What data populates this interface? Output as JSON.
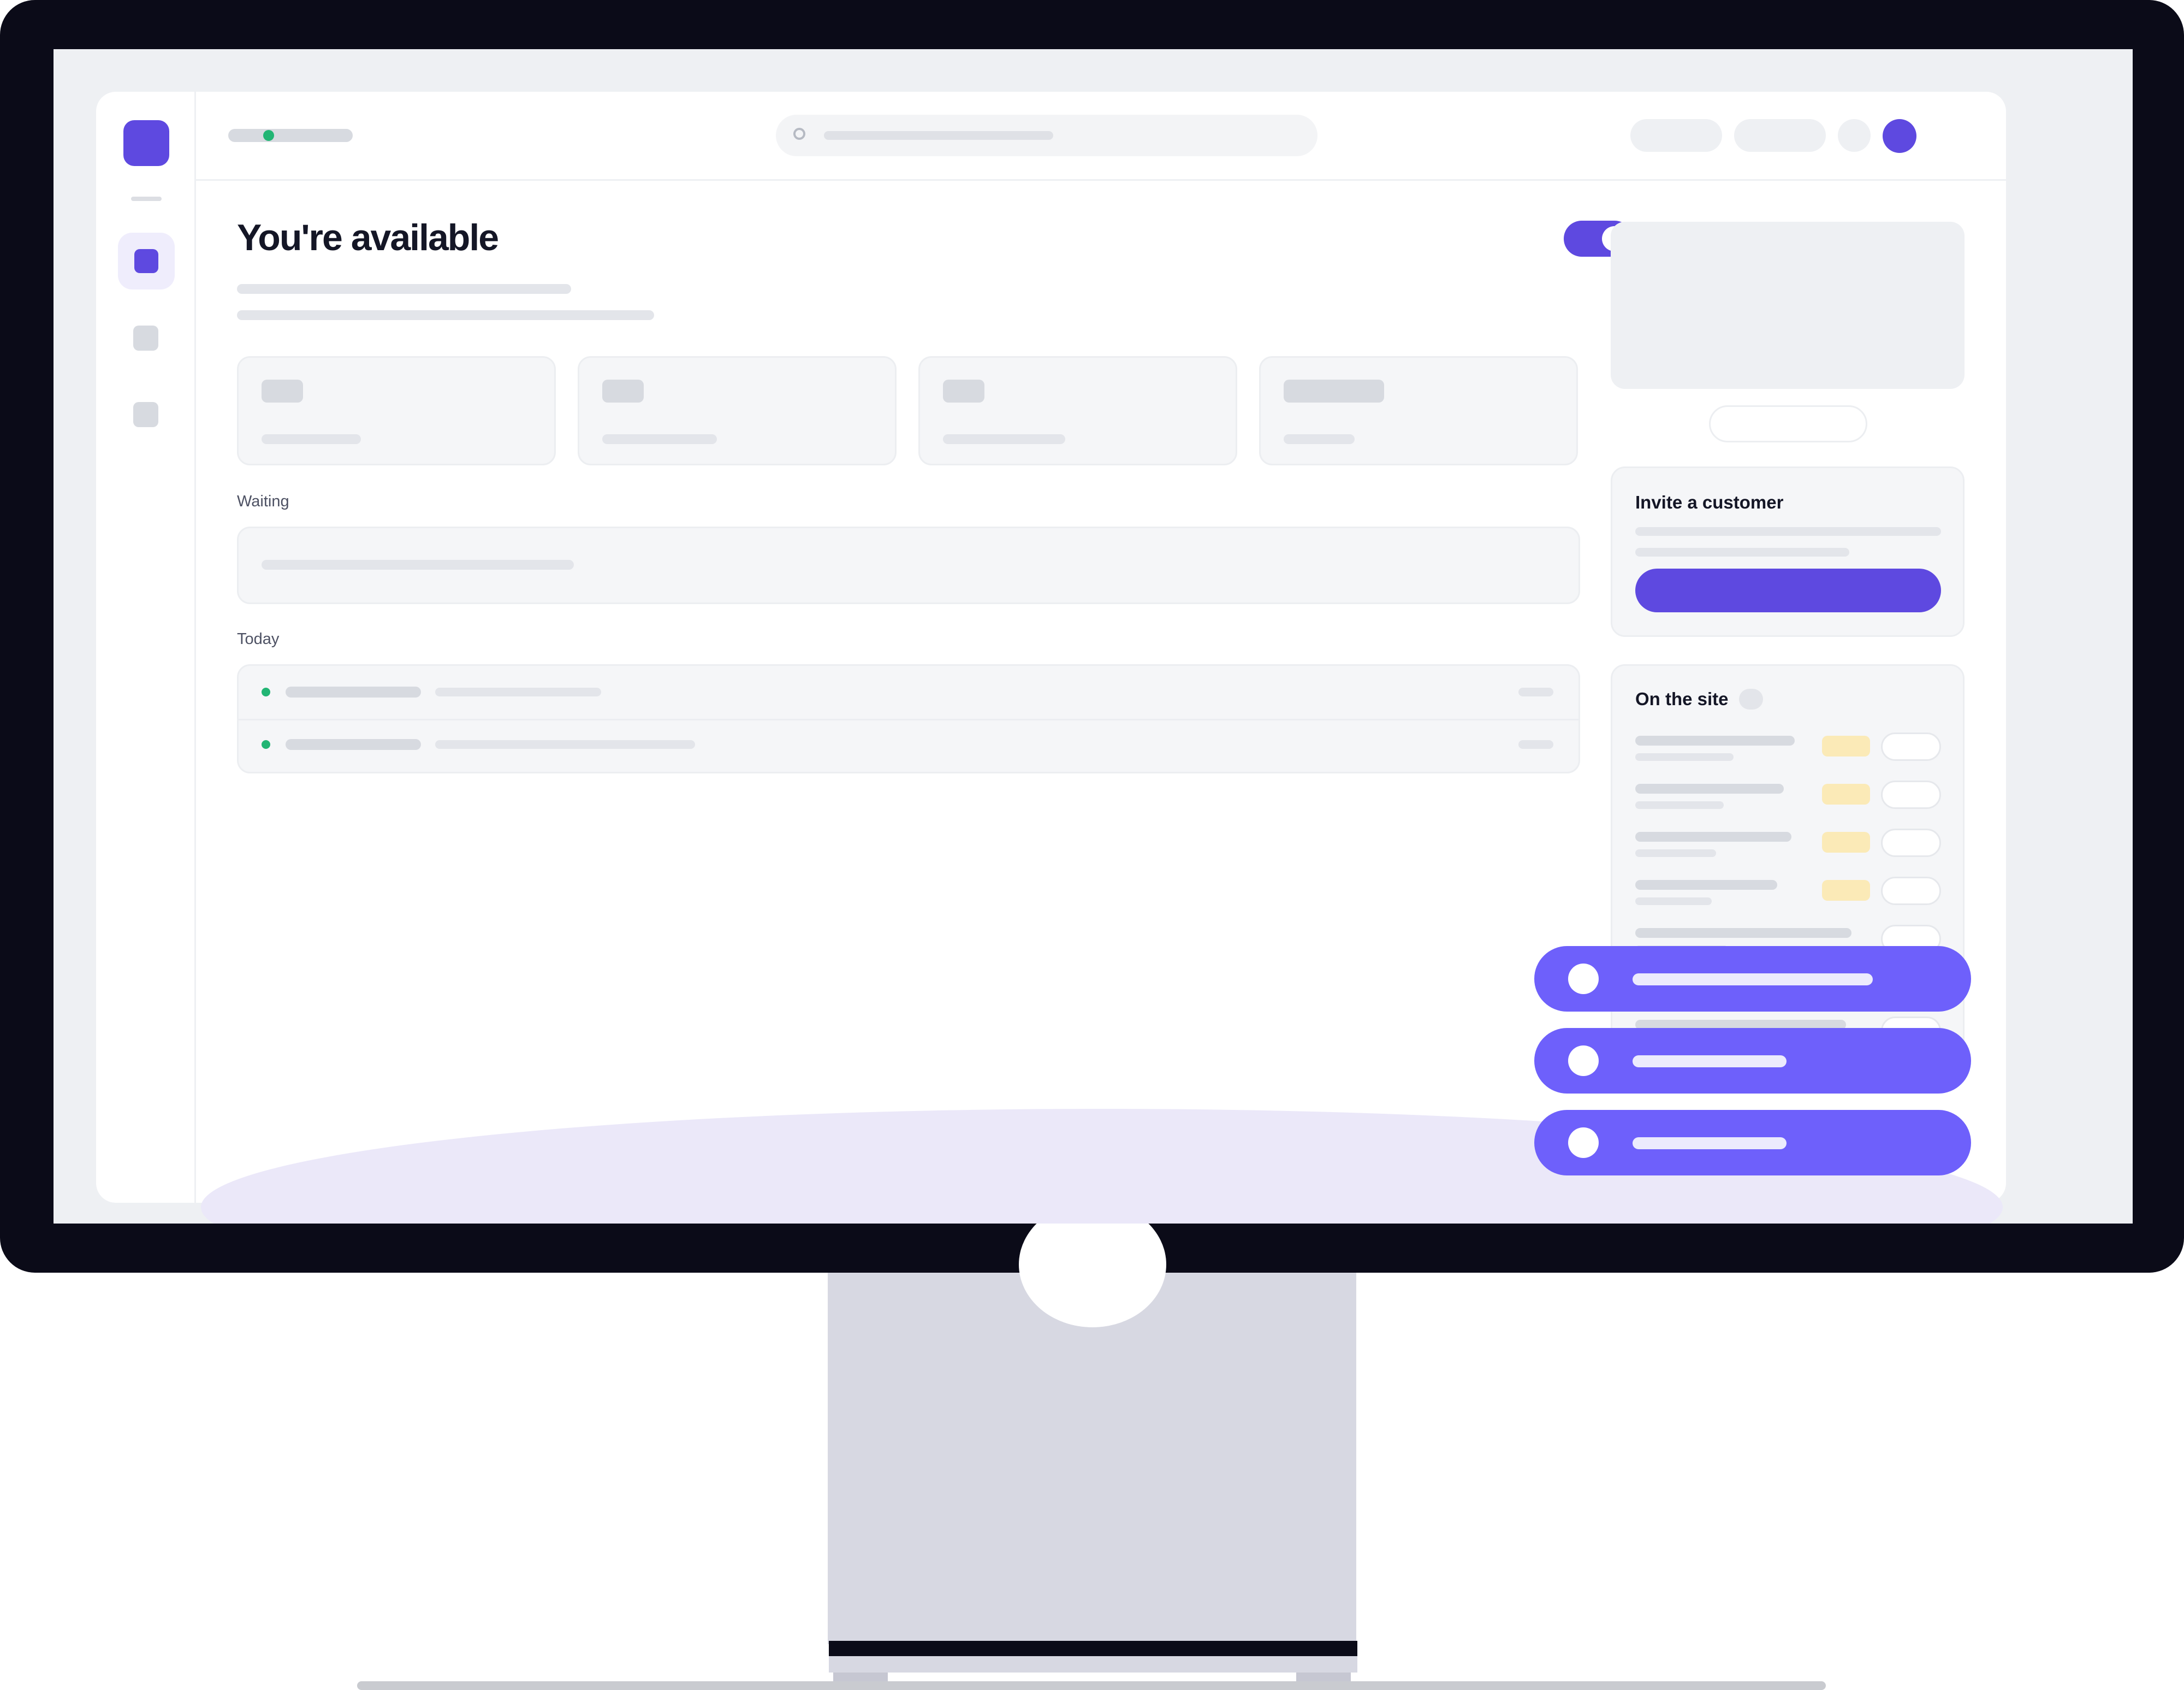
{
  "page": {
    "title": "You're available",
    "availability_on": true
  },
  "sections": {
    "waiting": "Waiting",
    "today": "Today"
  },
  "invite_card": {
    "title": "Invite a customer"
  },
  "on_site_card": {
    "title": "On the site"
  },
  "icons": {
    "search": "search-icon",
    "status": "status-dot-icon"
  },
  "colors": {
    "accent": "#5e49e0",
    "notification": "#6e60fb",
    "online": "#22b574",
    "tag": "#fbeab7",
    "bezel": "#0b0b18"
  }
}
